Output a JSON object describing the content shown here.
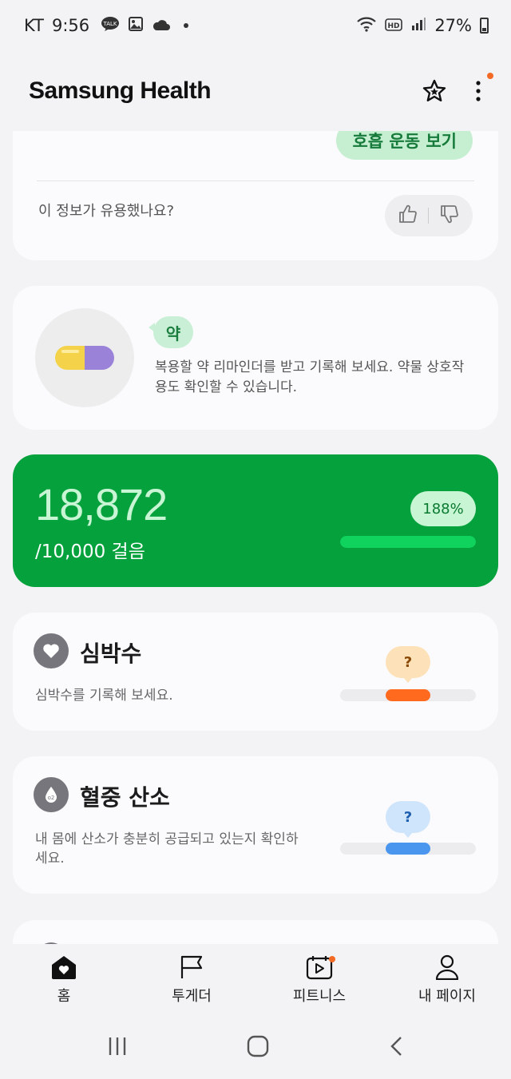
{
  "status_bar": {
    "carrier": "KT",
    "time": "9:56",
    "battery": "27%",
    "icons": [
      "kakaotalk-icon",
      "gallery-icon",
      "cloud-icon",
      "wifi-icon",
      "hd-icon",
      "signal-icon",
      "battery-icon"
    ]
  },
  "header": {
    "title": "Samsung Health"
  },
  "breathing_card": {
    "button_label": "호흡 운동 보기",
    "feedback_question": "이 정보가 유용했나요?"
  },
  "medication_card": {
    "badge": "약",
    "description": "복용할 약 리마인더를 받고 기록해 보세요. 약물 상호작용도 확인할 수 있습니다."
  },
  "steps_card": {
    "count": "18,872",
    "goal": "/10,000 걸음",
    "percent_label": "188%",
    "progress_fraction": 1.0
  },
  "heart_rate_card": {
    "title": "심박수",
    "description": "심박수를 기록해 보세요.",
    "bubble": "?"
  },
  "spo2_card": {
    "title": "혈중 산소",
    "description": "내 몸에 산소가 충분히 공급되고 있는지 확인하세요.",
    "bubble": "?"
  },
  "bottom_nav": {
    "items": [
      {
        "label": "홈",
        "icon": "home-heart-icon"
      },
      {
        "label": "투게더",
        "icon": "flag-icon"
      },
      {
        "label": "피트니스",
        "icon": "fitness-play-icon"
      },
      {
        "label": "내 페이지",
        "icon": "person-icon"
      }
    ]
  },
  "colors": {
    "steps_green": "#05a13c",
    "steps_fill": "#10d35e",
    "accent_orange": "#f36a24",
    "hr_segment": "#ff6a1f",
    "spo2_segment": "#4a95ee"
  }
}
